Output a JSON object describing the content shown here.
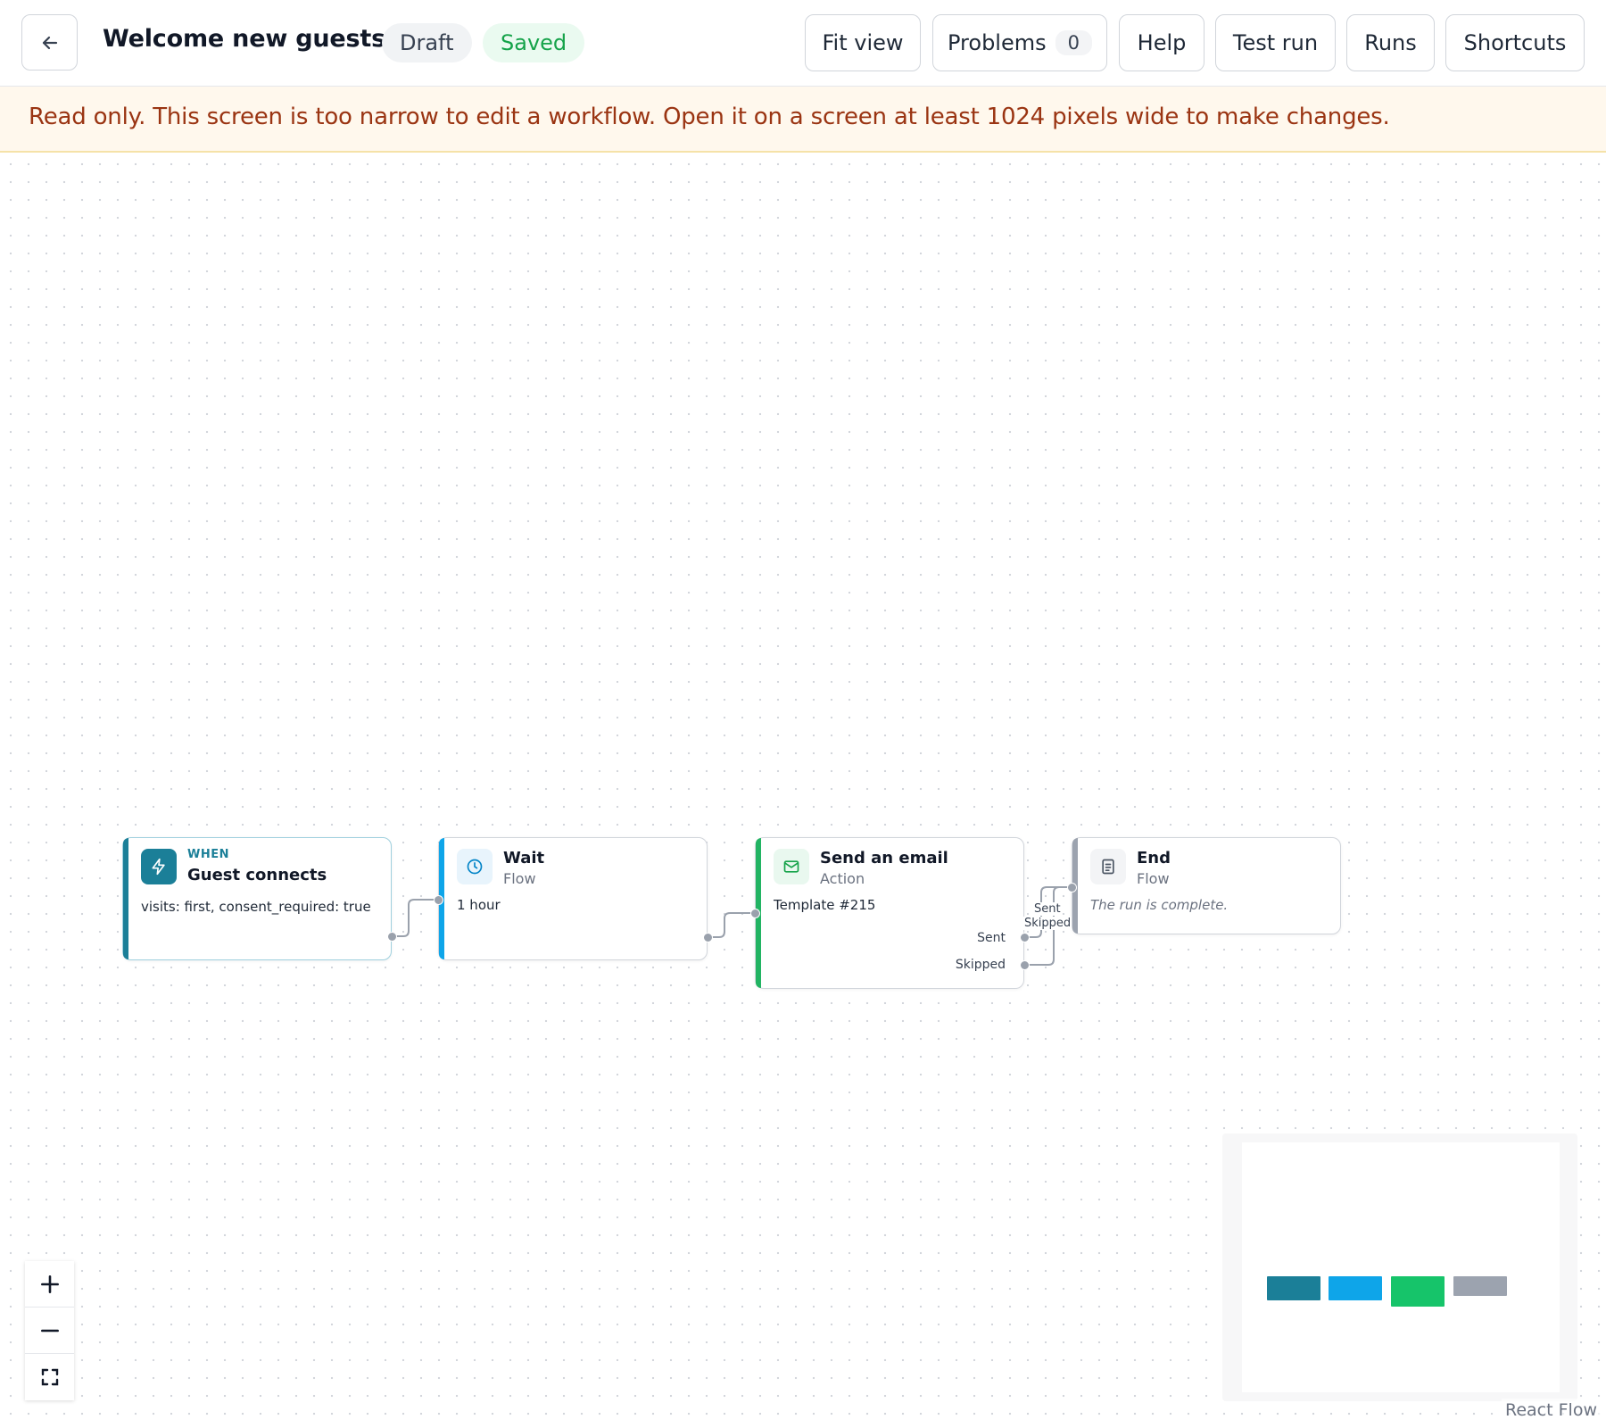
{
  "header": {
    "title": "Welcome new guests",
    "status_draft": "Draft",
    "status_saved": "Saved",
    "buttons": {
      "fit_view": "Fit view",
      "problems": "Problems",
      "problems_count": "0",
      "help": "Help",
      "test_run": "Test run",
      "runs": "Runs",
      "shortcuts": "Shortcuts"
    }
  },
  "banner": {
    "text": "Read only. This screen is too narrow to edit a workflow. Open it on a screen at least 1024 pixels wide to make changes."
  },
  "nodes": {
    "trigger": {
      "kicker": "WHEN",
      "title": "Guest connects",
      "body": "visits: first, consent_required: true",
      "color": "#1b7f98"
    },
    "wait": {
      "title": "Wait",
      "subtitle": "Flow",
      "body": "1 hour",
      "color": "#0ea5e9"
    },
    "email": {
      "title": "Send an email",
      "subtitle": "Action",
      "body": "Template #215",
      "port_sent": "Sent",
      "port_skipped": "Skipped",
      "color": "#22b463"
    },
    "end": {
      "title": "End",
      "subtitle": "Flow",
      "body": "The run is complete.",
      "color": "#9ca3af"
    }
  },
  "edges": {
    "sent_label": "Sent",
    "skipped_label": "Skipped"
  },
  "attribution": "React Flow",
  "icons": [
    "back-arrow-icon",
    "lightning-icon",
    "clock-icon",
    "envelope-icon",
    "document-icon",
    "plus-icon",
    "minus-icon",
    "fullscreen-icon"
  ]
}
